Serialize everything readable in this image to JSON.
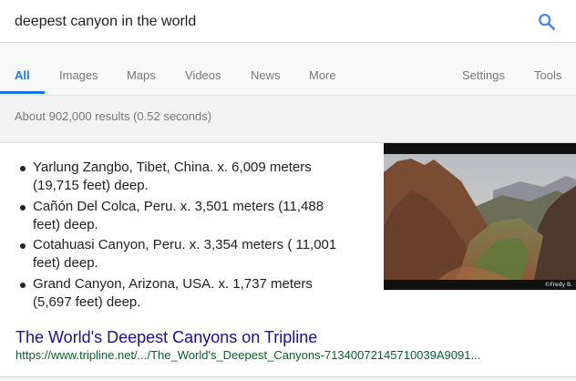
{
  "search": {
    "query": "deepest canyon in the world"
  },
  "tabs": [
    {
      "label": "All",
      "active": true
    },
    {
      "label": "Images"
    },
    {
      "label": "Maps"
    },
    {
      "label": "Videos"
    },
    {
      "label": "News"
    },
    {
      "label": "More"
    }
  ],
  "tools": {
    "settings_label": "Settings",
    "tools_label": "Tools"
  },
  "result_stats": "About 902,000 results (0.52 seconds)",
  "snippet": {
    "items": [
      {
        "line1": "Yarlung Zangbo, Tibet, China. x. 6,009 meters",
        "line2": "(19,715 feet) deep."
      },
      {
        "line1": "Cañón Del Colca, Peru. x. 3,501 meters (11,488",
        "line2": "feet) deep."
      },
      {
        "line1": "Cotahuasi Canyon, Peru. x. 3,354 meters ( 11,001",
        "line2": "feet) deep."
      },
      {
        "line1": "Grand Canyon, Arizona, USA. x. 1,737 meters",
        "line2": "(5,697 feet) deep."
      }
    ],
    "image_watermark": "©Fredy B.",
    "result_title": "The World's Deepest Canyons on Tripline",
    "result_url": "https://www.tripline.net/.../The_World's_Deepest_Canyons-7134007214571003​9A9091..."
  },
  "colors": {
    "accent": "#1a73e8",
    "link": "#1a0dab",
    "url": "#006621"
  }
}
